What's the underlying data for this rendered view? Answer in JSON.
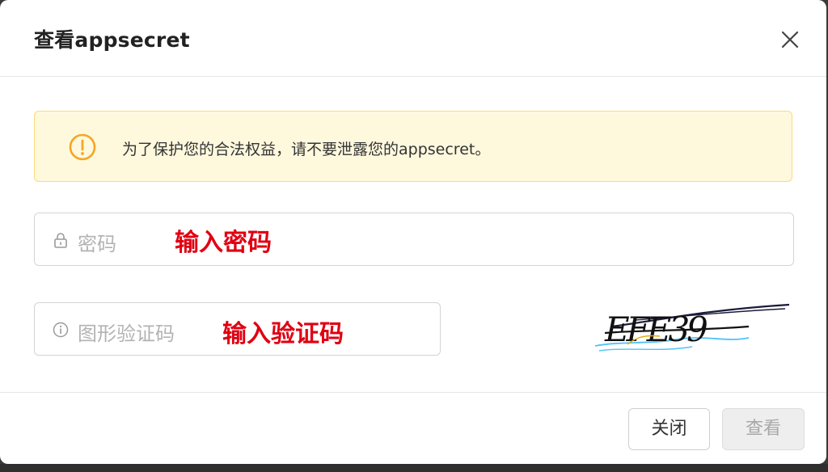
{
  "dialog": {
    "title": "查看appsecret",
    "close_icon": "close-icon"
  },
  "alert": {
    "icon": "warning-circle-icon",
    "text": "为了保护您的合法权益，请不要泄露您的appsecret。",
    "colors": {
      "background": "#fef8dd",
      "border": "#f7dc7b",
      "icon": "#f5a623"
    }
  },
  "form": {
    "password": {
      "icon": "lock-icon",
      "placeholder": "密码",
      "annotation": "输入密码"
    },
    "captcha": {
      "icon": "info-icon",
      "placeholder": "图形验证码",
      "annotation": "输入验证码",
      "image_text": "EFE39"
    }
  },
  "footer": {
    "close_label": "关闭",
    "view_label": "查看"
  },
  "colors": {
    "annotation": "#e00012"
  }
}
